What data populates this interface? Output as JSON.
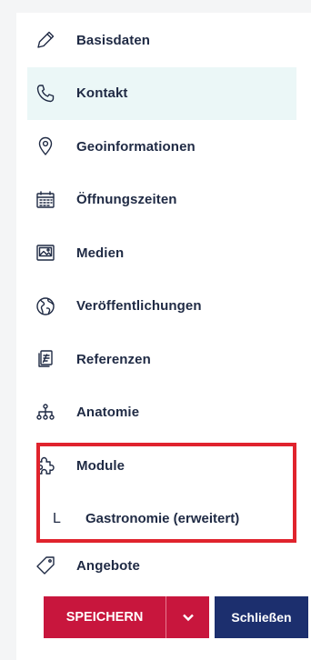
{
  "nav": {
    "items": [
      {
        "label": "Basisdaten",
        "icon": "pencil-icon"
      },
      {
        "label": "Kontakt",
        "icon": "phone-icon",
        "active": true
      },
      {
        "label": "Geoinformationen",
        "icon": "location-pin-icon"
      },
      {
        "label": "Öffnungszeiten",
        "icon": "calendar-icon"
      },
      {
        "label": "Medien",
        "icon": "image-icon"
      },
      {
        "label": "Veröffentlichungen",
        "icon": "globe-icon"
      },
      {
        "label": "Referenzen",
        "icon": "documents-icon"
      },
      {
        "label": "Anatomie",
        "icon": "hierarchy-icon"
      },
      {
        "label": "Module",
        "icon": "puzzle-icon"
      }
    ],
    "subitem": {
      "marker": "L",
      "label": "Gastronomie (erweitert)"
    },
    "last_item": {
      "label": "Angebote",
      "icon": "tag-icon"
    }
  },
  "footer": {
    "save_label": "SPEICHERN",
    "close_label": "Schließen"
  },
  "colors": {
    "active_bg": "#ebf7f7",
    "save": "#c8163d",
    "close": "#1c2f6e",
    "highlight": "#e0232d"
  }
}
